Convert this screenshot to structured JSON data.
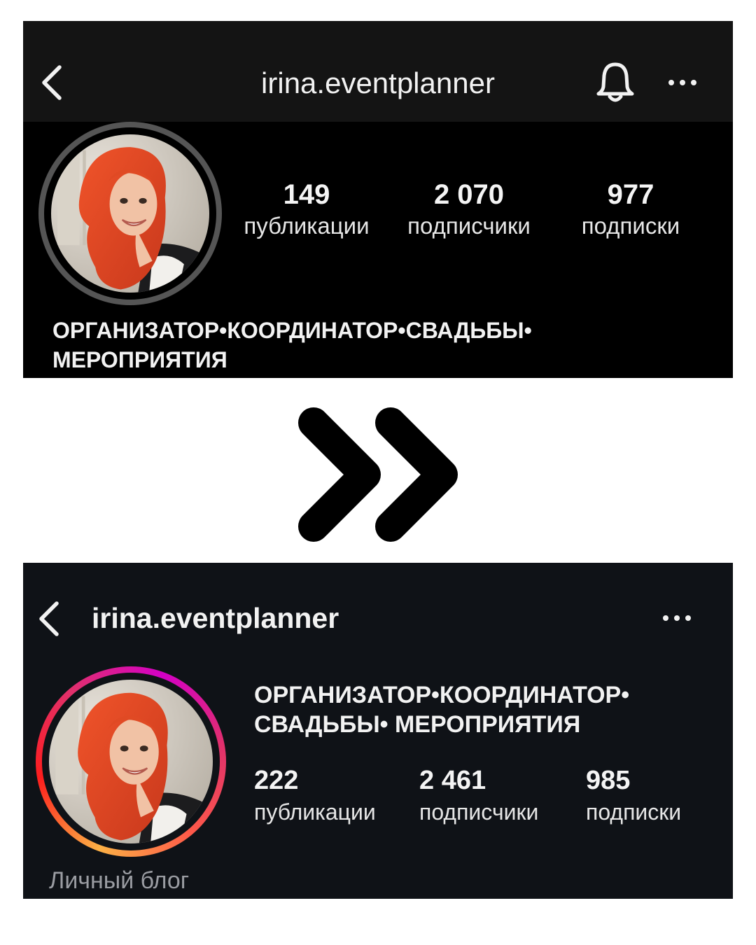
{
  "before": {
    "username": "irina.eventplanner",
    "icons": {
      "back": "chevron-left-icon",
      "notifications": "bell-icon",
      "more": "more-horizontal-icon"
    },
    "stats": [
      {
        "value": "149",
        "label": "публикации"
      },
      {
        "value": "2 070",
        "label": "подписчики"
      },
      {
        "value": "977",
        "label": "подписки"
      }
    ],
    "bio_line1": "ОРГАНИЗАТОР•КООРДИНАТОР•СВАДЬБЫ•",
    "bio_line2": "МЕРОПРИЯТИЯ"
  },
  "transition": {
    "icon": "double-chevron-right-icon"
  },
  "after": {
    "username": "irina.eventplanner",
    "icons": {
      "back": "chevron-left-icon",
      "more": "more-horizontal-icon"
    },
    "bio_line1": "ОРГАНИЗАТОР•КООРДИНАТОР•",
    "bio_line2": "СВАДЬБЫ• МЕРОПРИЯТИЯ",
    "stats": [
      {
        "value": "222",
        "label": "публикации"
      },
      {
        "value": "2 461",
        "label": "подписчики"
      },
      {
        "value": "985",
        "label": "подписки"
      }
    ],
    "category": "Личный блог"
  },
  "colors": {
    "panel_before_bg": "#000000",
    "topbar_before_bg": "#141414",
    "panel_after_bg": "#0f1217",
    "story_ring_gradient": [
      "#fcb045",
      "#fd1d1d",
      "#e1306c",
      "#d300c5"
    ]
  }
}
